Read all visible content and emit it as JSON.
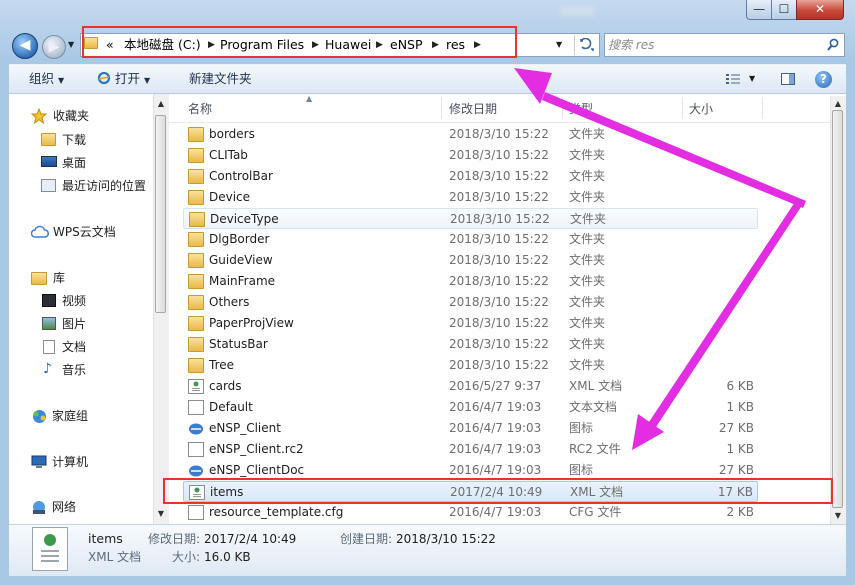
{
  "window": {
    "min_glyph": "—",
    "max_glyph": "☐",
    "close_glyph": "✕"
  },
  "nav": {
    "back_glyph": "◀",
    "forward_glyph": "▶",
    "dropdown_glyph": "▼"
  },
  "address": {
    "prefix": "«",
    "crumbs": [
      "本地磁盘 (C:)",
      "Program Files",
      "Huawei",
      "eNSP",
      "res"
    ],
    "separator": "▶"
  },
  "search": {
    "placeholder": "搜索 res"
  },
  "toolbar": {
    "organize": "组织",
    "open": "打开",
    "new_folder": "新建文件夹",
    "dropdown_glyph": "▼",
    "help_glyph": "?"
  },
  "sidebar": {
    "items": [
      {
        "label": "收藏夹",
        "icon": "star-icon"
      },
      {
        "label": "下载",
        "icon": "download-folder-icon"
      },
      {
        "label": "桌面",
        "icon": "desktop-icon"
      },
      {
        "label": "最近访问的位置",
        "icon": "recent-places-icon"
      },
      {
        "label": "WPS云文档",
        "icon": "cloud-icon"
      },
      {
        "label": "库",
        "icon": "library-icon"
      },
      {
        "label": "视频",
        "icon": "video-icon"
      },
      {
        "label": "图片",
        "icon": "picture-icon"
      },
      {
        "label": "文档",
        "icon": "document-icon"
      },
      {
        "label": "音乐",
        "icon": "music-icon"
      },
      {
        "label": "家庭组",
        "icon": "homegroup-icon"
      },
      {
        "label": "计算机",
        "icon": "computer-icon"
      },
      {
        "label": "网络",
        "icon": "network-icon"
      }
    ]
  },
  "columns": {
    "name": "名称",
    "date": "修改日期",
    "type": "类型",
    "size": "大小"
  },
  "files": [
    {
      "name": "borders",
      "date": "2018/3/10 15:22",
      "type": "文件夹",
      "size": "",
      "icon": "folder-icon"
    },
    {
      "name": "CLITab",
      "date": "2018/3/10 15:22",
      "type": "文件夹",
      "size": "",
      "icon": "folder-icon"
    },
    {
      "name": "ControlBar",
      "date": "2018/3/10 15:22",
      "type": "文件夹",
      "size": "",
      "icon": "folder-icon"
    },
    {
      "name": "Device",
      "date": "2018/3/10 15:22",
      "type": "文件夹",
      "size": "",
      "icon": "folder-icon"
    },
    {
      "name": "DeviceType",
      "date": "2018/3/10 15:22",
      "type": "文件夹",
      "size": "",
      "icon": "folder-icon"
    },
    {
      "name": "DlgBorder",
      "date": "2018/3/10 15:22",
      "type": "文件夹",
      "size": "",
      "icon": "folder-icon"
    },
    {
      "name": "GuideView",
      "date": "2018/3/10 15:22",
      "type": "文件夹",
      "size": "",
      "icon": "folder-icon"
    },
    {
      "name": "MainFrame",
      "date": "2018/3/10 15:22",
      "type": "文件夹",
      "size": "",
      "icon": "folder-icon"
    },
    {
      "name": "Others",
      "date": "2018/3/10 15:22",
      "type": "文件夹",
      "size": "",
      "icon": "folder-icon"
    },
    {
      "name": "PaperProjView",
      "date": "2018/3/10 15:22",
      "type": "文件夹",
      "size": "",
      "icon": "folder-icon"
    },
    {
      "name": "StatusBar",
      "date": "2018/3/10 15:22",
      "type": "文件夹",
      "size": "",
      "icon": "folder-icon"
    },
    {
      "name": "Tree",
      "date": "2018/3/10 15:22",
      "type": "文件夹",
      "size": "",
      "icon": "folder-icon"
    },
    {
      "name": "cards",
      "date": "2016/5/27 9:37",
      "type": "XML 文档",
      "size": "6 KB",
      "icon": "xml-file-icon"
    },
    {
      "name": "Default",
      "date": "2016/4/7 19:03",
      "type": "文本文档",
      "size": "1 KB",
      "icon": "text-file-icon"
    },
    {
      "name": "eNSP_Client",
      "date": "2016/4/7 19:03",
      "type": "图标",
      "size": "27 KB",
      "icon": "ensp-icon-file-icon"
    },
    {
      "name": "eNSP_Client.rc2",
      "date": "2016/4/7 19:03",
      "type": "RC2 文件",
      "size": "1 KB",
      "icon": "blank-file-icon"
    },
    {
      "name": "eNSP_ClientDoc",
      "date": "2016/4/7 19:03",
      "type": "图标",
      "size": "27 KB",
      "icon": "ensp-icon-file-icon"
    },
    {
      "name": "items",
      "date": "2017/2/4 10:49",
      "type": "XML 文档",
      "size": "17 KB",
      "icon": "xml-file-icon"
    },
    {
      "name": "resource_template.cfg",
      "date": "2016/4/7 19:03",
      "type": "CFG 文件",
      "size": "2 KB",
      "icon": "blank-file-icon"
    }
  ],
  "details": {
    "name": "items",
    "type": "XML 文档",
    "modified_label": "修改日期:",
    "modified_value": "2017/2/4 10:49",
    "created_label": "创建日期:",
    "created_value": "2018/3/10 15:22",
    "size_label": "大小:",
    "size_value": "16.0 KB"
  },
  "colors": {
    "annotation_red": "#e8342c",
    "annotation_magenta": "#e22de3",
    "selection_blue": "#d8e8f9"
  }
}
